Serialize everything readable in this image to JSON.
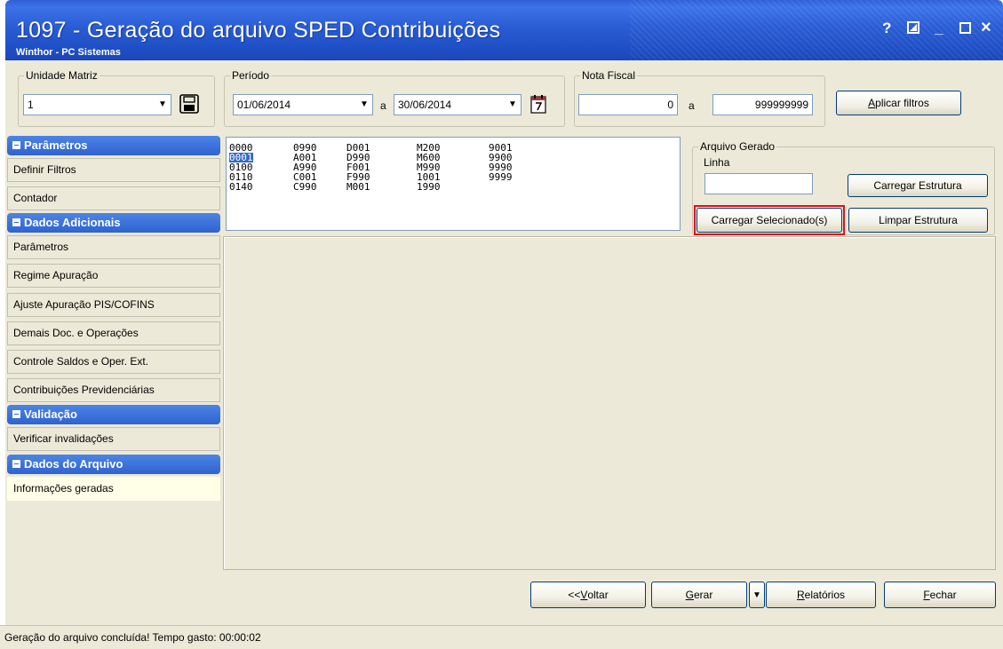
{
  "window": {
    "title": "1097 - Geração do arquivo SPED Contribuições",
    "subtitle": "Winthor - PC Sistemas",
    "controls": {
      "help": "?",
      "restore": "◩",
      "minimize": "_",
      "maximize": "□",
      "close": "×"
    }
  },
  "unidade": {
    "label": "Unidade Matriz",
    "value": "1"
  },
  "periodo": {
    "label": "Período",
    "start": "01/06/2014",
    "sep": "a",
    "end": "30/06/2014"
  },
  "nota_fiscal": {
    "label": "Nota Fiscal",
    "from": "0",
    "sep": "a",
    "to": "999999999"
  },
  "aplicar_filtros": {
    "underline": "A",
    "rest": "plicar filtros"
  },
  "sidebar": {
    "parametros_header": "Parâmetros",
    "definir_filtros": "Definir Filtros",
    "contador": "Contador",
    "dados_adicionais_header": "Dados Adicionais",
    "parametros": "Parâmetros",
    "regime_apuracao": "Regime Apuração",
    "ajuste_apuracao": "Ajuste Apuração PIS/COFINS",
    "demais_doc": "Demais Doc. e Operações",
    "controle_saldos": "Controle Saldos e Oper. Ext.",
    "contribuicoes_prev": "Contribuições Previdenciárias",
    "validacao_header": "Validação",
    "verificar_invalidacoes": "Verificar invalidações",
    "dados_arquivo_header": "Dados do Arquivo",
    "informacoes_geradas": "Informações geradas"
  },
  "registros": {
    "col1": [
      "0000",
      "0001",
      "0100",
      "0110",
      "0140"
    ],
    "col2": [
      "0990",
      "A001",
      "A990",
      "C001",
      "C990"
    ],
    "col3": [
      "D001",
      "D990",
      "F001",
      "F990",
      "M001"
    ],
    "col4": [
      "M200",
      "M600",
      "M990",
      "1001",
      "1990"
    ],
    "col5": [
      "9001",
      "9900",
      "9990",
      "9999"
    ],
    "selected": "0001"
  },
  "arquivo_gerado": {
    "label": "Arquivo Gerado",
    "linha_label": "Linha",
    "linha_value": "",
    "carregar_estrutura": "Carregar Estrutura",
    "carregar_selecionados": "Carregar Selecionado(s)",
    "limpar_estrutura": "Limpar Estrutura"
  },
  "footer_buttons": {
    "voltar": {
      "pre": "<< ",
      "underline": "V",
      "rest": "oltar"
    },
    "gerar": {
      "underline": "G",
      "rest": "erar"
    },
    "relatorios": {
      "underline": "R",
      "rest": "elatórios"
    },
    "fechar": {
      "underline": "F",
      "rest": "echar"
    }
  },
  "status": "Geração do arquivo concluída! Tempo gasto: 00:00:02",
  "colors": {
    "title_blue": "#2a5cd4",
    "section_blue": "#3a6fd8",
    "highlight_red": "#e0101a",
    "selection": "#316ac5"
  }
}
